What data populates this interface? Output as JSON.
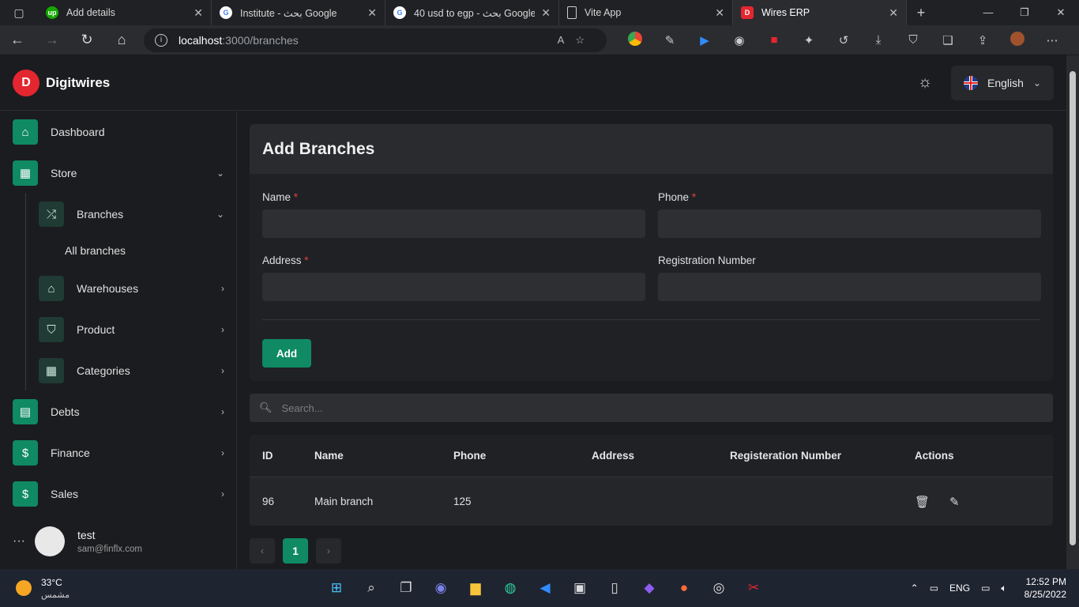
{
  "browser": {
    "tabs": [
      {
        "title": "Add details",
        "favicon": "upwork",
        "color": "#14a800"
      },
      {
        "title": "Institute - بحث Google",
        "favicon": "google",
        "color": "#4285f4"
      },
      {
        "title": "40 usd to egp - بحث Google",
        "favicon": "google",
        "color": "#4285f4"
      },
      {
        "title": "Vite App",
        "favicon": "document",
        "color": "#888888"
      },
      {
        "title": "Wires ERP",
        "favicon": "digitwires",
        "color": "#e3262f"
      }
    ],
    "url_host": "localhost",
    "url_path": ":3000/branches"
  },
  "app": {
    "brand": "Digitwires",
    "language": "English",
    "accent": "#0f8a63",
    "sidebar": {
      "dashboard": "Dashboard",
      "store": "Store",
      "branches": "Branches",
      "all_branches": "All branches",
      "warehouses": "Warehouses",
      "product": "Product",
      "categories": "Categories",
      "debts": "Debts",
      "finance": "Finance",
      "sales": "Sales"
    },
    "user": {
      "name": "test",
      "email": "sam@finflx.com"
    }
  },
  "form": {
    "title": "Add Branches",
    "name_label": "Name",
    "phone_label": "Phone",
    "address_label": "Address",
    "registration_label": "Registration Number",
    "required_mark": "*",
    "submit": "Add"
  },
  "search": {
    "placeholder": "Search..."
  },
  "table": {
    "headers": {
      "id": "ID",
      "name": "Name",
      "phone": "Phone",
      "address": "Address",
      "registration": "Registeration Number",
      "actions": "Actions"
    },
    "rows": [
      {
        "id": "96",
        "name": "Main branch",
        "phone": "125",
        "address": "",
        "registration": ""
      }
    ]
  },
  "pagination": {
    "prev": "‹",
    "current": "1",
    "next": "›"
  },
  "taskbar": {
    "temperature": "33°C",
    "weather": "مشمس",
    "lang": "ENG",
    "time": "12:52 PM",
    "date": "8/25/2022"
  }
}
